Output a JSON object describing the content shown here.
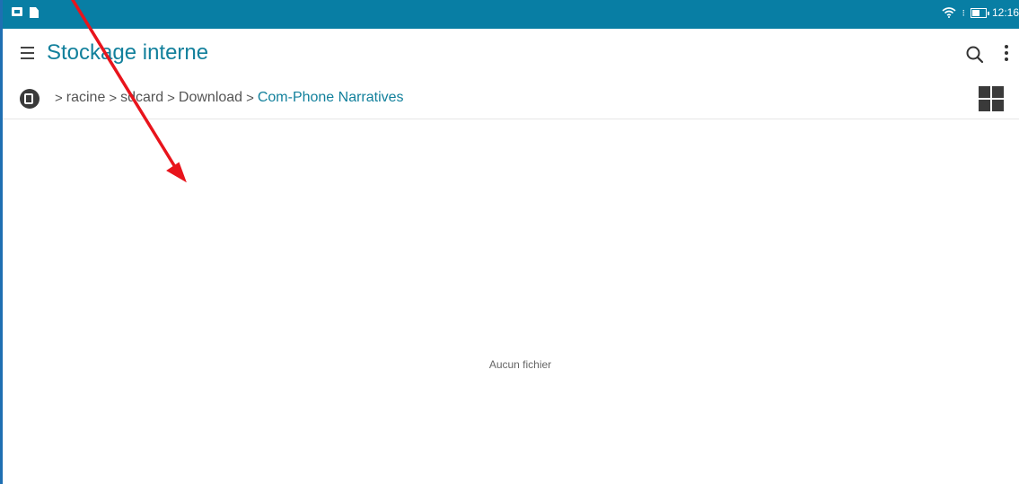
{
  "status_bar": {
    "time": "12:16",
    "left_icons": [
      "photo-notification-icon",
      "file-notification-icon"
    ],
    "right_icons": [
      "wifi-icon",
      "sim-icon",
      "battery-icon"
    ]
  },
  "app_bar": {
    "title": "Stockage interne",
    "menu_icon": "hamburger-icon",
    "actions": [
      "search-icon",
      "overflow-menu-icon"
    ]
  },
  "breadcrumb": {
    "root_icon": "storage-icon",
    "items": [
      "racine",
      "sdcard",
      "Download",
      "Com-Phone Narratives"
    ],
    "view_toggle_icon": "grid-view-icon"
  },
  "content": {
    "empty_message": "Aucun fichier"
  },
  "colors": {
    "status_bar": "#087ea4",
    "accent": "#12809c",
    "annotation_arrow": "#e8141c"
  }
}
